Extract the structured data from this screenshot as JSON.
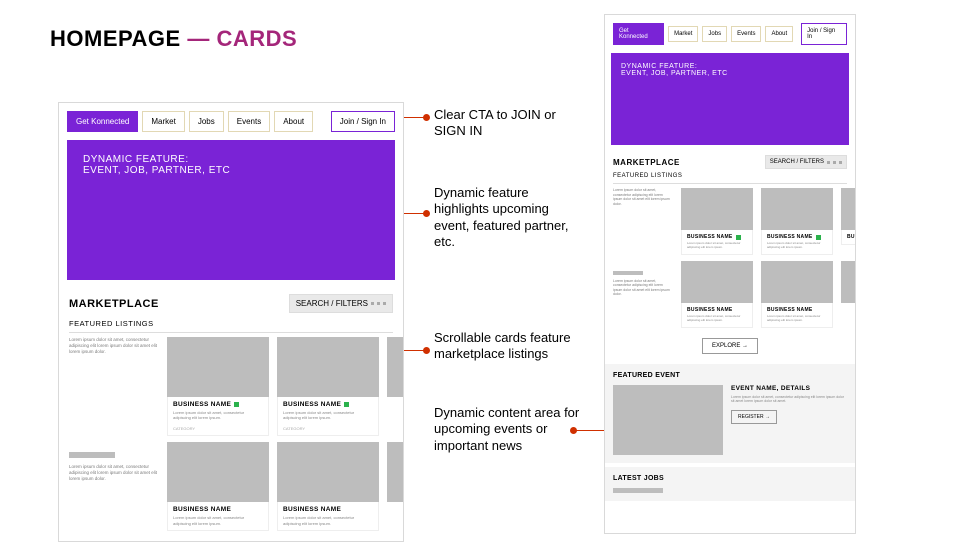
{
  "page_title": {
    "a": "HOMEPAGE",
    "dash": " — ",
    "b": "CARDS"
  },
  "nav": {
    "cta": "Get Konnected",
    "items": [
      "Market",
      "Jobs",
      "Events",
      "About"
    ],
    "join": "Join / Sign In"
  },
  "hero": {
    "line1": "DYNAMIC FEATURE:",
    "line2": "EVENT, JOB, PARTNER, ETC"
  },
  "marketplace": {
    "title": "MARKETPLACE",
    "filters": "SEARCH / FILTERS",
    "featured_label": "FEATURED LISTINGS",
    "blurb": "Lorem ipsum dolor sit amet, consectetur adipiscing elit lorem ipsum dolor sit amet elit lorem ipsum dolor.",
    "card": {
      "name": "BUSINESS NAME",
      "desc": "Lorem ipsum dolor sit amet, consectetur adipiscing elit lorem ipsum.",
      "cat": "CATEGORY"
    },
    "explore": "EXPLORE →"
  },
  "featured_event": {
    "label": "FEATURED EVENT",
    "name": "EVENT NAME, DETAILS",
    "desc": "Lorem ipsum dolor sit amet, consectetur adipiscing elit lorem ipsum dolor sit amet lorem ipsum dolor sit amet.",
    "register": "REGISTER →"
  },
  "latest_jobs": {
    "label": "LATEST JOBS"
  },
  "annotations": {
    "a1": "Clear CTA to JOIN or SIGN IN",
    "a2": "Dynamic feature highlights upcoming event, featured partner, etc.",
    "a3": "Scrollable cards feature marketplace listings",
    "a4": "Dynamic content area for upcoming events or important news"
  }
}
